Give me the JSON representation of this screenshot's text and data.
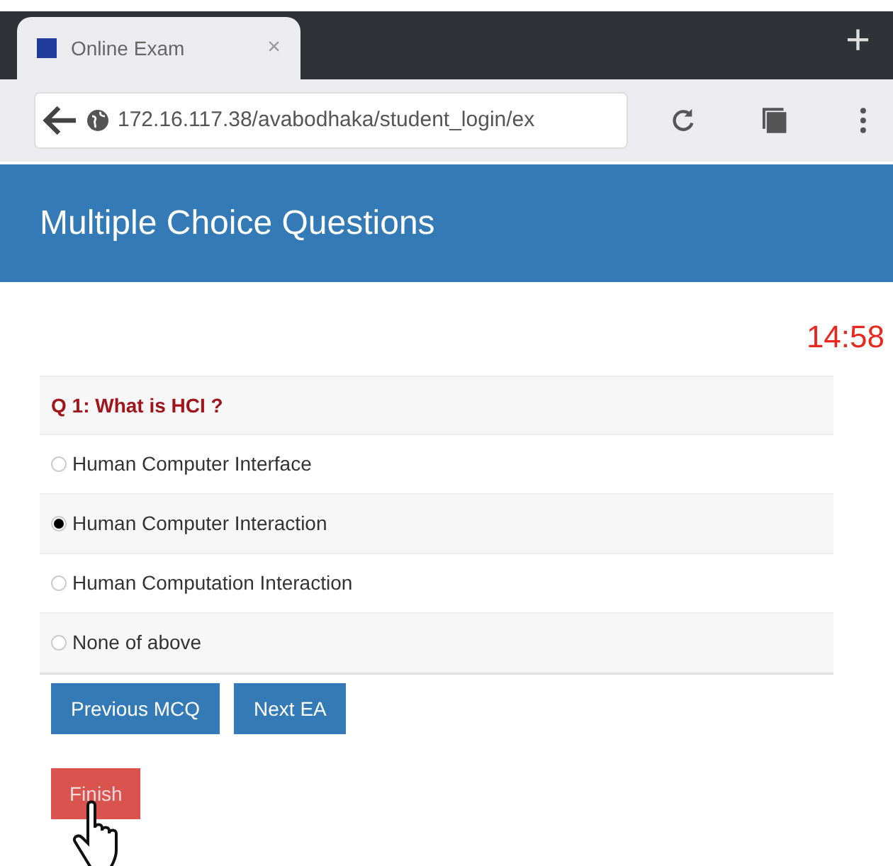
{
  "browser": {
    "tab_title": "Online Exam",
    "tab_close": "×",
    "new_tab": "+",
    "url": "172.16.117.38/avabodhaka/student_login/ex"
  },
  "header": {
    "title": "Multiple Choice Questions"
  },
  "timer": "14:58",
  "question": {
    "text": "Q 1: What is HCI ?",
    "options": [
      {
        "label": "Human Computer Interface",
        "selected": false
      },
      {
        "label": "Human Computer Interaction",
        "selected": true
      },
      {
        "label": "Human Computation Interaction",
        "selected": false
      },
      {
        "label": "None of above",
        "selected": false
      }
    ]
  },
  "buttons": [
    {
      "label": "Previous MCQ",
      "kind": "primary"
    },
    {
      "label": "Next EA",
      "kind": "primary"
    }
  ],
  "finish": {
    "label": "Finish",
    "kind": "danger"
  }
}
